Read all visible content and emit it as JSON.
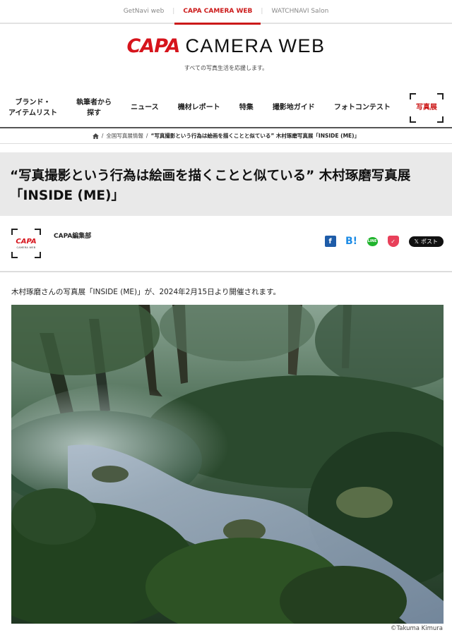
{
  "topbar": {
    "links": [
      "GetNavi web",
      "CAPA CAMERA WEB",
      "WATCHNAVI Salon"
    ],
    "separator": "|"
  },
  "header": {
    "logo_capa": "CAPA",
    "logo_rest": "CAMERA WEB",
    "tagline": "すべての写真生活を応援します。"
  },
  "nav": {
    "items": [
      {
        "line1": "ブランド・",
        "line2": "アイテムリスト"
      },
      {
        "line1": "執筆者から",
        "line2": "探す"
      },
      {
        "line1": "ニュース",
        "line2": ""
      },
      {
        "line1": "機材レポート",
        "line2": ""
      },
      {
        "line1": "特集",
        "line2": ""
      },
      {
        "line1": "撮影地ガイド",
        "line2": ""
      },
      {
        "line1": "フォトコンテスト",
        "line2": ""
      },
      {
        "line1": "写真展",
        "line2": ""
      }
    ]
  },
  "breadcrumb": {
    "sep": "/",
    "level1": "全国写真展情報",
    "current": "“写真撮影という行為は絵画を描くことと似ている” 木村琢磨写真展「INSIDE (ME)」"
  },
  "article": {
    "title_line1": "“写真撮影という行為は絵画を描くことと似ている” 木村琢磨写真展",
    "title_line2": "「INSIDE (ME)」",
    "author": "CAPA編集部",
    "avatar_capa": "CAPA",
    "avatar_sub": "CAMERA WEB",
    "lead": "木村琢磨さんの写真展「INSIDE (ME)」が、2024年2月15日より開催されます。",
    "photo_credit": "©Takuma Kimura"
  },
  "share": {
    "facebook": "f",
    "hatena": "B!",
    "line": "LINE",
    "pocket": "✓",
    "x_label": "ポスト",
    "x_glyph": "𝕏"
  },
  "colors": {
    "brand_red": "#cc1a1a",
    "title_band": "#e9e9e9"
  }
}
